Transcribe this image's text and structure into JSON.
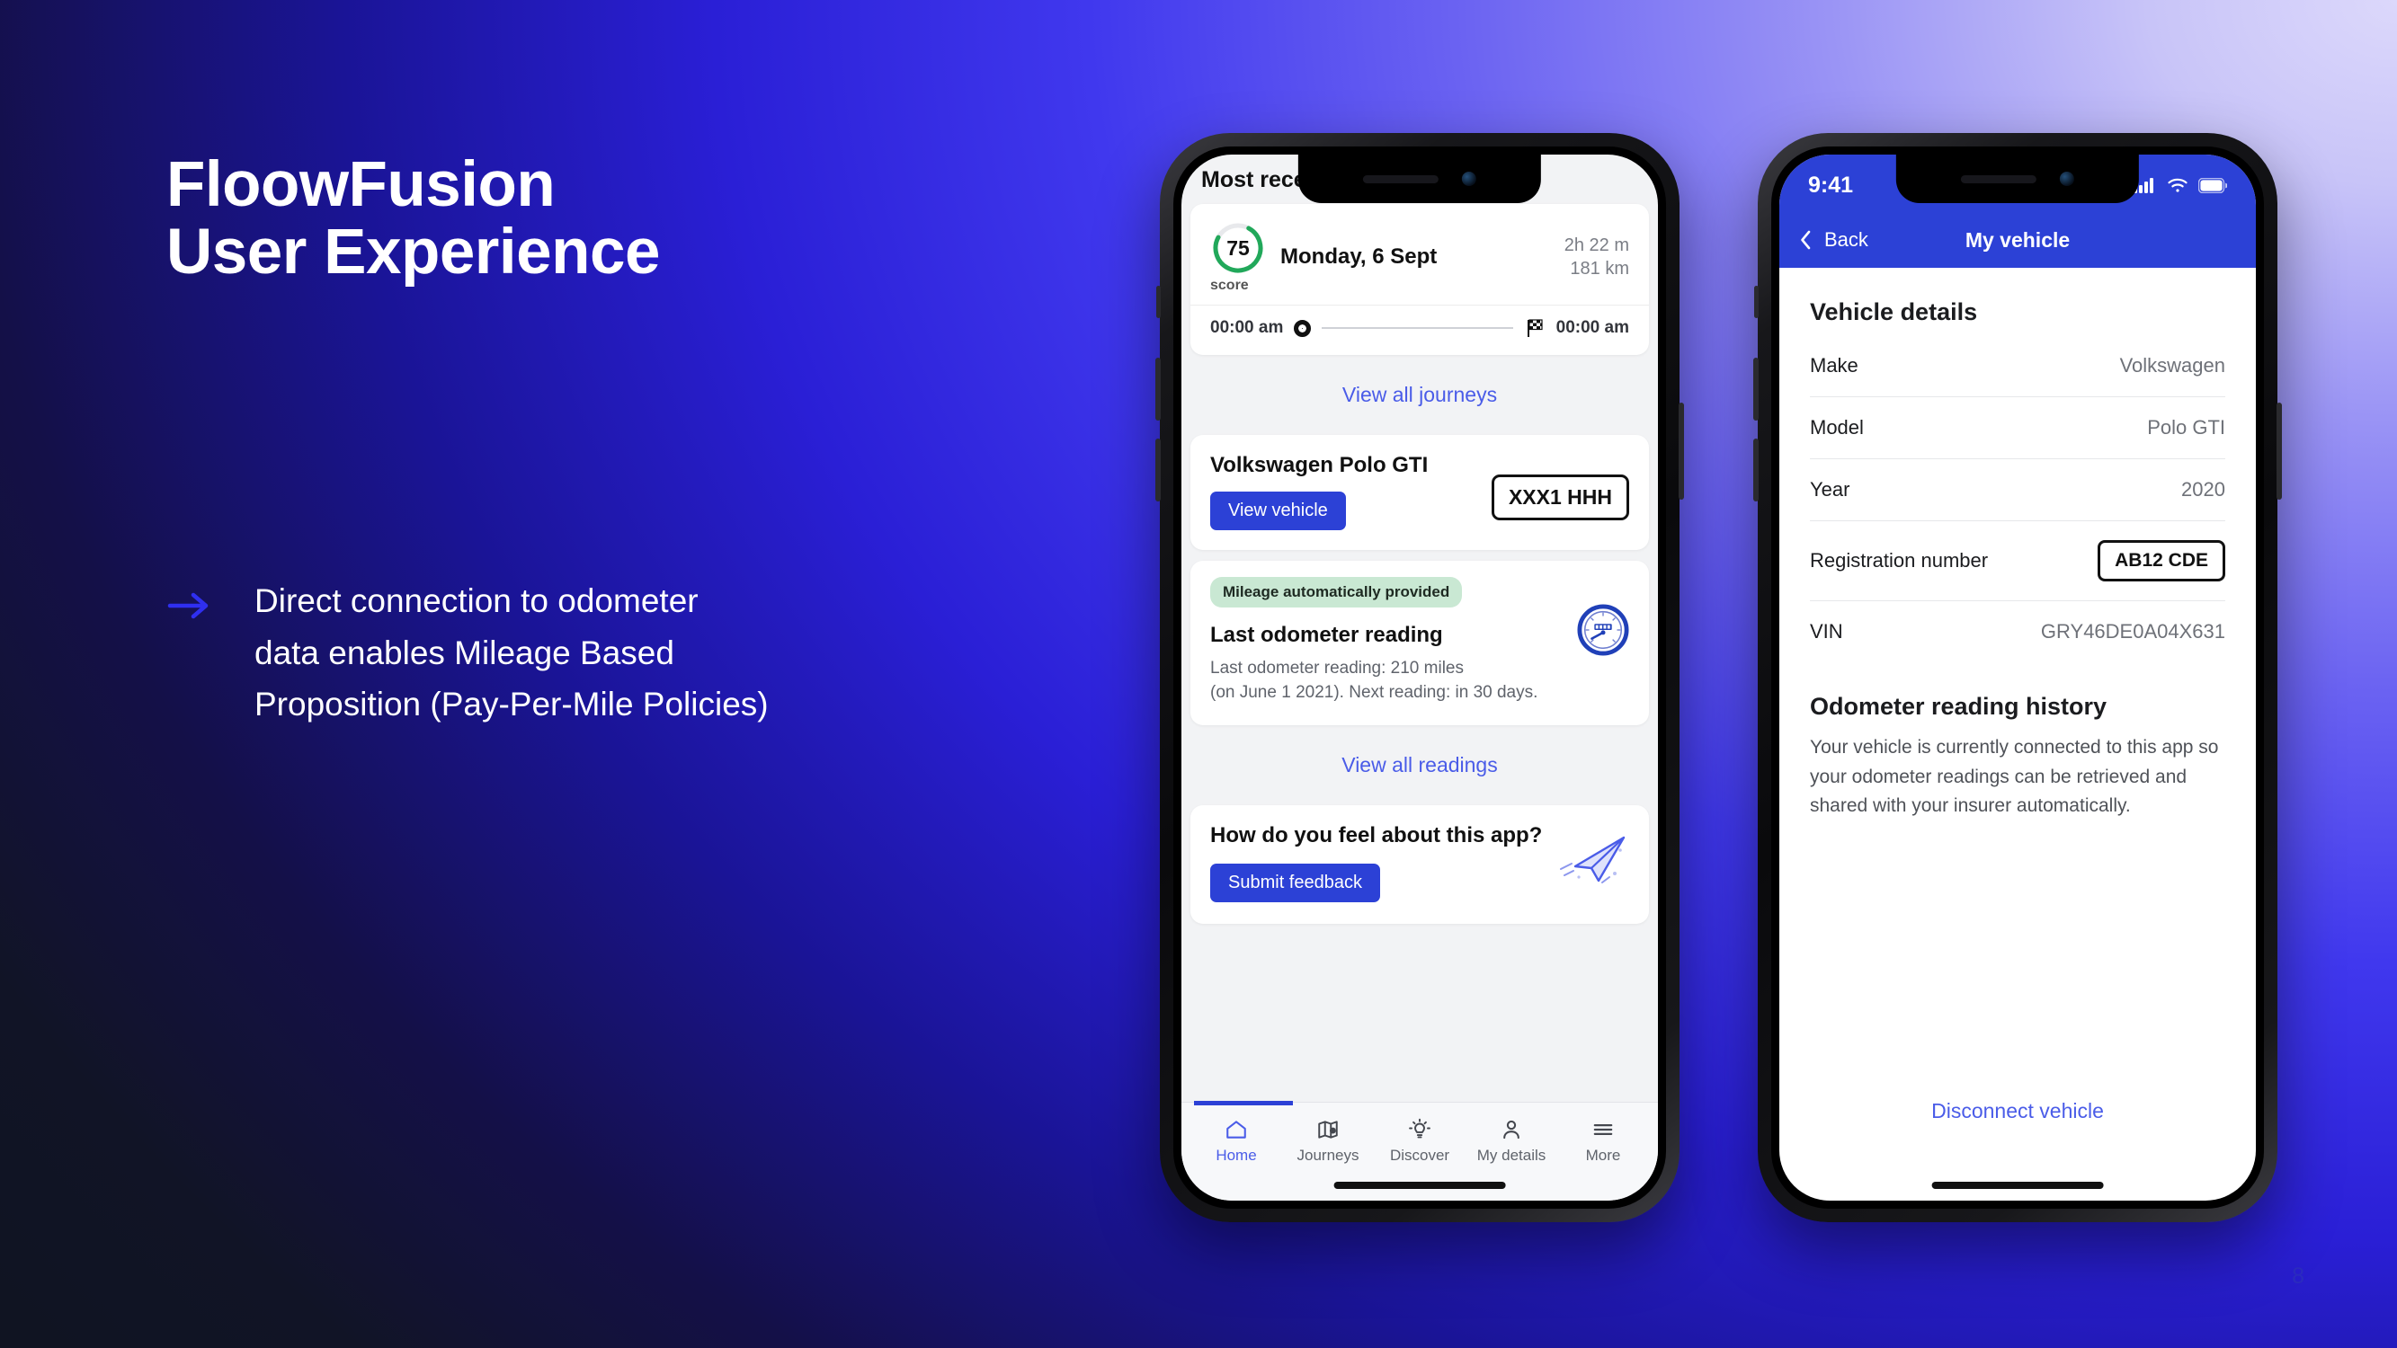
{
  "slide": {
    "headline": "FloowFusion\nUser Experience",
    "bullet": "Direct connection to odometer\ndata enables Mileage Based\nProposition (Pay-Per-Mile Policies)",
    "page_number": "8",
    "accent_color": "#2c41d6",
    "link_color": "#4a5ce8"
  },
  "phone_home": {
    "section_title": "Most recent journey",
    "journey": {
      "score": "75",
      "score_label": "score",
      "date": "Monday, 6 Sept",
      "duration": "2h 22 m",
      "distance": "181 km",
      "start_time": "00:00 am",
      "end_time": "00:00 am",
      "score_percent": 75,
      "ring_color": "#21a85a"
    },
    "view_all_journeys": "View all journeys",
    "vehicle": {
      "name": "Volkswagen Polo GTI",
      "view_button": "View vehicle",
      "plate": "XXX1 HHH"
    },
    "odometer": {
      "badge": "Mileage automatically provided",
      "badge_color": "#c9e8d3",
      "title": "Last odometer reading",
      "detail": "Last odometer reading: 210 miles\n(on June 1 2021). Next reading: in 30 days.",
      "icon": "odometer-gauge-icon"
    },
    "view_all_readings": "View all readings",
    "feedback": {
      "title": "How do you feel about this app?",
      "button": "Submit feedback",
      "icon": "paper-plane-icon"
    },
    "tabs": [
      {
        "label": "Home",
        "icon": "home-icon",
        "active": true
      },
      {
        "label": "Journeys",
        "icon": "map-pin-icon",
        "active": false
      },
      {
        "label": "Discover",
        "icon": "lightbulb-icon",
        "active": false
      },
      {
        "label": "My details",
        "icon": "person-icon",
        "active": false
      },
      {
        "label": "More",
        "icon": "hamburger-icon",
        "active": false
      }
    ]
  },
  "phone_vehicle": {
    "status_bar": {
      "time": "9:41",
      "icons": [
        "cellular-signal-icon",
        "wifi-icon",
        "battery-icon"
      ]
    },
    "nav": {
      "back": "Back",
      "title": "My vehicle"
    },
    "section_title": "Vehicle details",
    "details": [
      {
        "label": "Make",
        "value": "Volkswagen",
        "type": "text"
      },
      {
        "label": "Model",
        "value": "Polo GTI",
        "type": "text"
      },
      {
        "label": "Year",
        "value": "2020",
        "type": "text"
      },
      {
        "label": "Registration number",
        "value": "AB12 CDE",
        "type": "plate"
      },
      {
        "label": "VIN",
        "value": "GRY46DE0A04X631",
        "type": "text"
      }
    ],
    "history_title": "Odometer reading history",
    "history_text": "Your vehicle is currently connected to this app so your odometer readings can be retrieved and shared with your insurer automatically.",
    "disconnect": "Disconnect vehicle"
  }
}
